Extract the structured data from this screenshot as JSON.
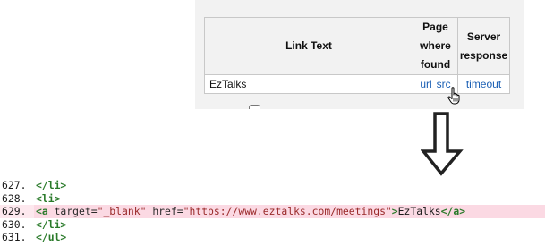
{
  "table": {
    "headers": {
      "link_text": "Link Text",
      "page_where_found": [
        "Page",
        "where",
        "found"
      ],
      "server_response": [
        "Server",
        "response"
      ]
    },
    "row": {
      "link_text": "EzTalks",
      "url_link": "url",
      "src_link": "src",
      "response": "timeout"
    }
  },
  "code": {
    "lines": [
      {
        "num": "627.",
        "parts": [
          {
            "t": "tag",
            "v": "</li>"
          }
        ]
      },
      {
        "num": "628.",
        "parts": [
          {
            "t": "tag",
            "v": "<li>"
          }
        ]
      },
      {
        "num": "629.",
        "highlight": true,
        "parts": [
          {
            "t": "tag",
            "v": "<a "
          },
          {
            "t": "attr",
            "v": "target="
          },
          {
            "t": "val",
            "v": "\"_blank\""
          },
          {
            "t": "attr",
            "v": " href="
          },
          {
            "t": "val",
            "v": "\"https://www.eztalks.com/meetings\""
          },
          {
            "t": "tag",
            "v": ">"
          },
          {
            "t": "txt",
            "v": "EzTalks"
          },
          {
            "t": "tag",
            "v": "</a>"
          }
        ]
      },
      {
        "num": "630.",
        "parts": [
          {
            "t": "tag",
            "v": "</li>"
          }
        ]
      },
      {
        "num": "631.",
        "parts": [
          {
            "t": "tag",
            "v": "</ul>"
          }
        ]
      }
    ]
  },
  "colors": {
    "link": "#1a5fb4",
    "code_tag": "#2a7a2a",
    "code_value": "#9a2a2a",
    "highlight": "#fbd9e3"
  },
  "icons": [
    "hand-pointer-icon",
    "down-arrow-icon"
  ]
}
